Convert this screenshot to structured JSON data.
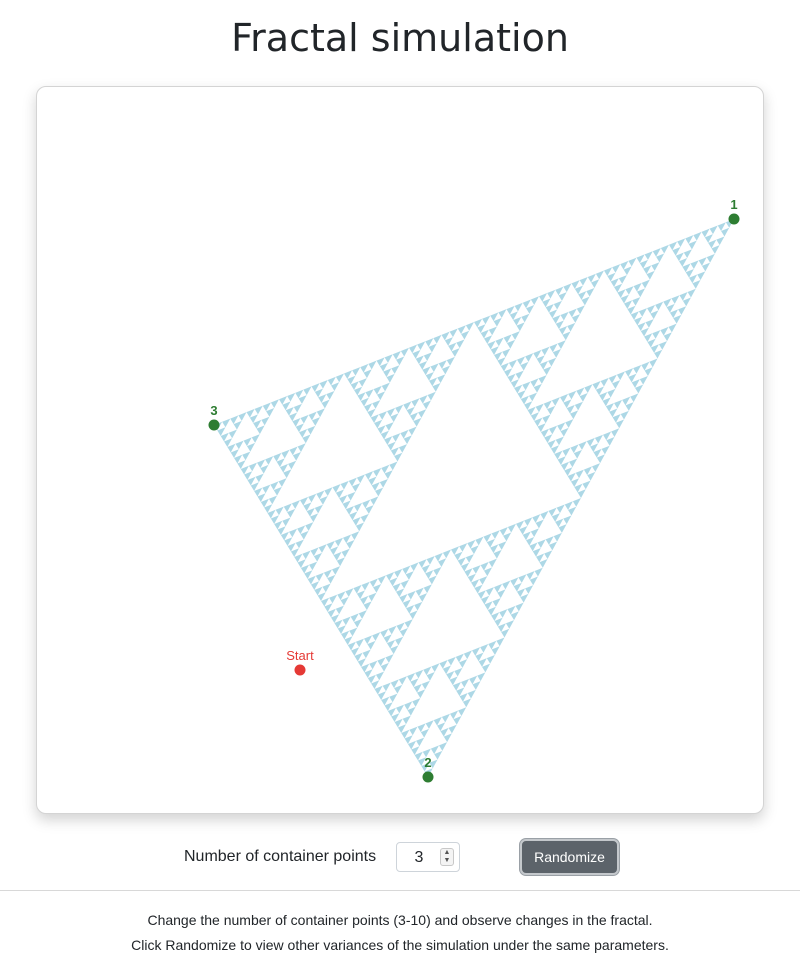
{
  "page": {
    "title": "Fractal simulation"
  },
  "simulation": {
    "fractal_color": "#add8e6",
    "container_point_color": "#2e7d32",
    "start_point_color": "#e53935",
    "container_points": [
      {
        "label": "1"
      },
      {
        "label": "2"
      },
      {
        "label": "3"
      }
    ],
    "start_label": "Start"
  },
  "controls": {
    "points_label": "Number of container points",
    "points_value": "3",
    "randomize_label": "Randomize"
  },
  "instructions": {
    "line1": "Change the number of container points (3-10) and observe changes in the fractal.",
    "line2": "Click Randomize to view other variances of the simulation under the same parameters."
  }
}
